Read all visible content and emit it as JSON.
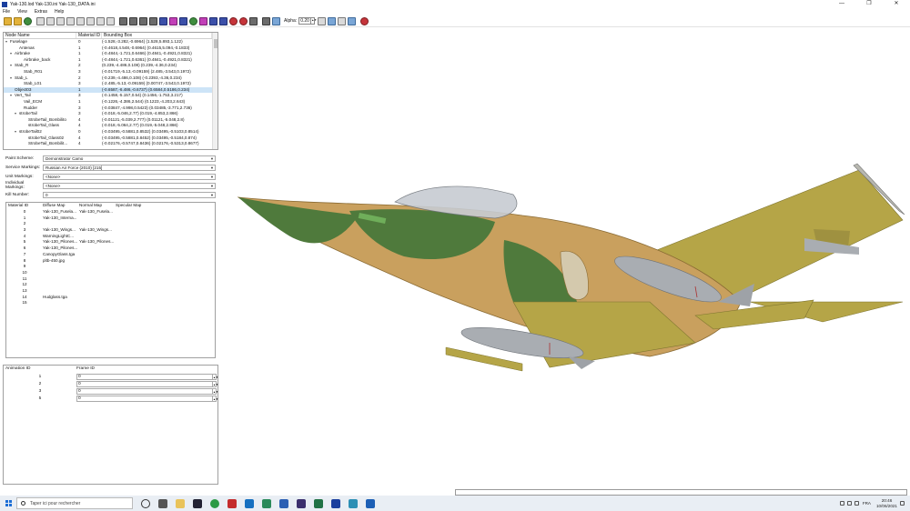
{
  "window": {
    "title": "Yak-130.lod  Yak-130.ini  Yak-130_DATA.ini",
    "min": "—",
    "max": "❐",
    "close": "✕"
  },
  "menu": [
    "File",
    "View",
    "Extras",
    "Help"
  ],
  "toolbar": {
    "alpha_label": "Alpha:",
    "alpha_value": "0.20"
  },
  "tree": {
    "headers": {
      "name": "Node Name",
      "material": "Material ID",
      "bbox": "Bounding Box"
    },
    "rows": [
      {
        "name": "Fuselage",
        "indent": 0,
        "arrow": "v",
        "mat": "0",
        "bbox": "(-1.528,-3.282,-0.6964) (1.528,5.893,1.122)"
      },
      {
        "name": "Antenas",
        "indent": 2,
        "arrow": "",
        "mat": "1",
        "bbox": "(-0.4618,4.548,-0.6964) (0.4615,5.094,-0.1833)"
      },
      {
        "name": "Airbrake",
        "indent": 1,
        "arrow": "v",
        "mat": "1",
        "bbox": "(-0.4844,-1.721,0.6466) (0.4841,-0.4921,0.8321)"
      },
      {
        "name": "Airbrake_back",
        "indent": 3,
        "arrow": "",
        "mat": "1",
        "bbox": "(-0.4844,-1.721,0.6361) (0.4841,-0.4921,0.8321)"
      },
      {
        "name": "Stab_R",
        "indent": 1,
        "arrow": "v",
        "mat": "2",
        "bbox": "(0.239,-4.486,0.108) (0.239,-4.36,0.234)"
      },
      {
        "name": "Stab_R01",
        "indent": 3,
        "arrow": "",
        "mat": "3",
        "bbox": "(-0.01719,-5.13,-0.09159) (2.485,-3.543,0.1972)"
      },
      {
        "name": "Stab_L",
        "indent": 1,
        "arrow": "v",
        "mat": "2",
        "bbox": "(-0.239,-4.486,0.108) (-0.2393,-4.36,0.234)"
      },
      {
        "name": "Stab_L01",
        "indent": 3,
        "arrow": "",
        "mat": "3",
        "bbox": "(-2.485,-5.13,-0.09159) (0.00747,-3.543,0.1972)"
      },
      {
        "name": "Object03",
        "indent": 1,
        "arrow": "",
        "mat": "1",
        "bbox": "(-0.6587,-6.486,-0.6737) (0.6584,0.5186,0.234)",
        "selected": true
      },
      {
        "name": "Vert_Tail",
        "indent": 1,
        "arrow": "v",
        "mat": "3",
        "bbox": "(-0.1458,-5.157,0.54) (0.1456,-1.753,3.217)"
      },
      {
        "name": "Vail_ECM",
        "indent": 3,
        "arrow": "",
        "mat": "1",
        "bbox": "(-0.1226,-4.386,2.544) (0.1223,-4.203,2.643)"
      },
      {
        "name": "Rudder",
        "indent": 3,
        "arrow": "",
        "mat": "3",
        "bbox": "(-0.03847,-4.998,0.5423) (0.03485,-3.771,2.736)"
      },
      {
        "name": "strobeTail",
        "indent": 2,
        "arrow": "v",
        "mat": "3",
        "bbox": "(-0.018,-5.046,2.77) (0.019,-4.853,2.866)"
      },
      {
        "name": "StrobeTail_Bombilito",
        "indent": 4,
        "arrow": "",
        "mat": "4",
        "bbox": "(-0.01121,-5.039,2.777) (0.01121,-5.048,2.8)"
      },
      {
        "name": "strobeTail_Glass",
        "indent": 4,
        "arrow": "",
        "mat": "4",
        "bbox": "(-0.018,-5.064,2.77) (0.019,-5.048,2.866)"
      },
      {
        "name": "strobeTail02",
        "indent": 2,
        "arrow": "v",
        "mat": "0",
        "bbox": "(-0.03495,-0.5881,0.8532) (0.03495,-0.5103,0.8514)"
      },
      {
        "name": "strobeTail_Glass02",
        "indent": 4,
        "arrow": "",
        "mat": "4",
        "bbox": "(-0.03495,-0.5881,0.8452) (0.03495,-0.5184,0.874)"
      },
      {
        "name": "StrobeTail_Bombilit...",
        "indent": 4,
        "arrow": "",
        "mat": "4",
        "bbox": "(-0.02176,-0.5747,0.8436) (0.02176,-0.5313,0.8677)"
      }
    ]
  },
  "form": {
    "paint_scheme": {
      "label": "Paint Scheme:",
      "value": "Demonstrator Camo"
    },
    "service_markings": {
      "label": "Service Markings:",
      "value": "Russian Air Force (2010) [215]"
    },
    "unit_markings": {
      "label": "Unit Markings:",
      "value": "<None>"
    },
    "individual_markings": {
      "label": "Individual Markings:",
      "value": "<None>"
    },
    "kill_number": {
      "label": "Kill Number:",
      "value": "0"
    }
  },
  "materials": {
    "headers": {
      "id": "Material ID",
      "diffuse": "Diffuse Map",
      "normal": "Normal Map",
      "specular": "Specular Map"
    },
    "rows": [
      {
        "id": "0",
        "diffuse": "Yak-130_Fusela...",
        "normal": "Yak-130_Fusela...",
        "specular": ""
      },
      {
        "id": "1",
        "diffuse": "Yak-130_Interna...",
        "normal": "",
        "specular": ""
      },
      {
        "id": "2",
        "diffuse": "",
        "normal": "",
        "specular": ""
      },
      {
        "id": "3",
        "diffuse": "Yak-130_Wings...",
        "normal": "Yak-130_Wings...",
        "specular": ""
      },
      {
        "id": "4",
        "diffuse": "WarningLightC...",
        "normal": "",
        "specular": ""
      },
      {
        "id": "5",
        "diffuse": "Yak-130_Pilones...",
        "normal": "Yak-130_Pilones...",
        "specular": ""
      },
      {
        "id": "6",
        "diffuse": "Yak-130_Pilones...",
        "normal": "",
        "specular": ""
      },
      {
        "id": "7",
        "diffuse": "CanopyGlass.tga",
        "normal": "",
        "specular": ""
      },
      {
        "id": "8",
        "diffuse": "pltb-450.jpg",
        "normal": "",
        "specular": ""
      },
      {
        "id": "9",
        "diffuse": "",
        "normal": "",
        "specular": ""
      },
      {
        "id": "10",
        "diffuse": "",
        "normal": "",
        "specular": ""
      },
      {
        "id": "11",
        "diffuse": "",
        "normal": "",
        "specular": ""
      },
      {
        "id": "12",
        "diffuse": "",
        "normal": "",
        "specular": ""
      },
      {
        "id": "13",
        "diffuse": "",
        "normal": "",
        "specular": ""
      },
      {
        "id": "14",
        "diffuse": "Hudglass.tga",
        "normal": "",
        "specular": ""
      },
      {
        "id": "15",
        "diffuse": "",
        "normal": "",
        "specular": ""
      }
    ]
  },
  "animation": {
    "headers": {
      "id": "Animation ID",
      "frame": "Frame ID"
    },
    "rows": [
      {
        "id": "1",
        "frame": "0"
      },
      {
        "id": "2",
        "frame": "0"
      },
      {
        "id": "3",
        "frame": "0"
      },
      {
        "id": "5",
        "frame": "0"
      }
    ]
  },
  "colors": {
    "camo_tan": "#c9a05e",
    "camo_green": "#4f7a3c",
    "wing_yellow": "#b8a845",
    "pod_grey": "#a9adb2"
  },
  "taskbar": {
    "search_placeholder": "Taper ici pour rechercher",
    "language": "FRA",
    "time": "20:46",
    "date": "10/06/2021"
  }
}
